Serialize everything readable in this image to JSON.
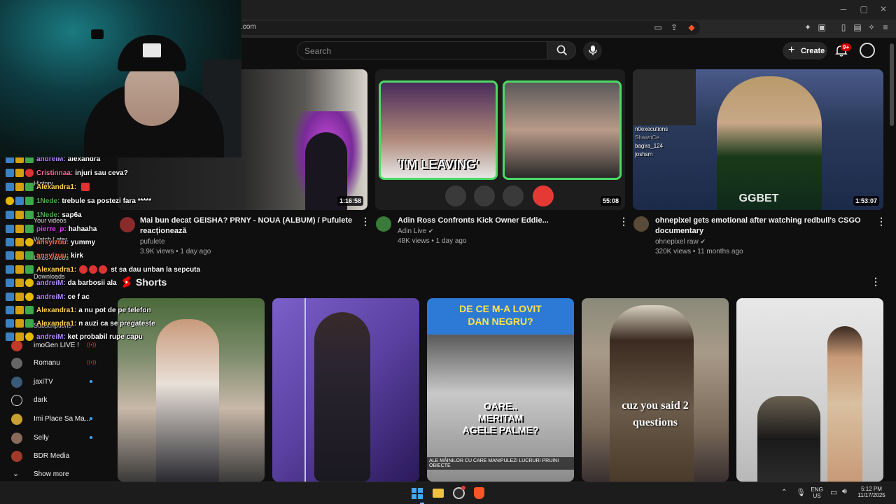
{
  "browser": {
    "url_fragment": ".com"
  },
  "header": {
    "search_placeholder": "Search",
    "create_label": "Create",
    "notification_count": "9+"
  },
  "videos": [
    {
      "title_line1": "Mai bun decat GEISHA? PRNY - NOUA (ALBUM) / Pufulete",
      "title_line2": "reacționează",
      "channel": "pufulete",
      "meta": "3.9K views • 1 day ago",
      "duration": "1:16:58"
    },
    {
      "title_line1": "Adin Ross Confronts Kick Owner Eddie...",
      "title_line2": "",
      "channel": "Adin Live",
      "meta": "48K views • 1 day ago",
      "duration": "55:08",
      "thumb_text": "'I'M LEAVING'"
    },
    {
      "title_line1": "ohnepixel gets emotional after watching redbull's CSGO",
      "title_line2": "documentary",
      "channel": "ohnepixel raw",
      "meta": "320K views • 11 months ago",
      "duration": "1:53:07",
      "thumb_chat": [
        "n0executions",
        "ShawnCe",
        "bagira_124",
        "joshsm"
      ],
      "jersey_text": "GGBET"
    }
  ],
  "shorts": {
    "section_title": "Shorts",
    "items": [
      {
        "text": ""
      },
      {
        "text": ""
      },
      {
        "text_top": "DE CE M-A LOVIT DAN NEGRU?",
        "text_mid": "OARE.. MERITAM AGELE PALME?",
        "text_bottom": "ALE MÂINILOR CU CARE MANIPULEZI LUCRURI PRUINI OBIECTE"
      },
      {
        "text_mid": "cuz you said 2 questions"
      },
      {
        "text": ""
      }
    ]
  },
  "sidebar": {
    "faded": [
      "History",
      "Your videos",
      "Watch Later",
      "Liked videos",
      "Downloads",
      "Subscriptions"
    ],
    "items": [
      {
        "name": "imoGen LIVE !",
        "status": "live",
        "color": "#c0392b"
      },
      {
        "name": "Romanu",
        "status": "live",
        "color": "#666"
      },
      {
        "name": "jaxiTV",
        "status": "new",
        "color": "#3a5a7a"
      },
      {
        "name": "dark",
        "status": "",
        "color": "#222"
      },
      {
        "name": "Imi Place Sa Ma...",
        "status": "new",
        "color": "#c8a030"
      },
      {
        "name": "Selly",
        "status": "new",
        "color": "#8a6a5a"
      },
      {
        "name": "BDR Media",
        "status": "",
        "color": "#a03a2a"
      },
      {
        "name": "Show more",
        "status": "",
        "color": ""
      }
    ]
  },
  "chat": [
    {
      "user": "andreiM:",
      "msg": "alexandra",
      "color": "#b388ff"
    },
    {
      "user": "Cristinnaa:",
      "msg": "injuri sau ceva?",
      "color": "#ff6b9d"
    },
    {
      "user": "Alexandra1:",
      "msg": "",
      "color": "#ffd54f"
    },
    {
      "user": "1Nede:",
      "msg": "trebule sa postezi fara *****",
      "color": "#4caf50"
    },
    {
      "user": "1Nede:",
      "msg": "sap6a",
      "color": "#4caf50"
    },
    {
      "user": "pierre_p:",
      "msg": "hahaaha",
      "color": "#e040fb"
    },
    {
      "user": "ansyizuu:",
      "msg": "yummy",
      "color": "#ff7043"
    },
    {
      "user": "ansyizuu:",
      "msg": "kirk",
      "color": "#ff7043"
    },
    {
      "user": "Alexandra1:",
      "msg": "st sa dau unban la sepcuta",
      "color": "#ffd54f"
    },
    {
      "user": "andreiM:",
      "msg": "da barbosii ala",
      "color": "#b388ff"
    },
    {
      "user": "andreiM:",
      "msg": "ce f ac",
      "color": "#b388ff"
    },
    {
      "user": "Alexandra1:",
      "msg": "a nu pot de pe telefon",
      "color": "#ffd54f"
    },
    {
      "user": "Alexandra1:",
      "msg": "n auzi ca se pregateste",
      "color": "#ffd54f"
    },
    {
      "user": "andreiM:",
      "msg": "ket probabil rupe capu",
      "color": "#b388ff"
    }
  ],
  "taskbar": {
    "lang_top": "ENG",
    "lang_bottom": "US",
    "time": "5:12 PM",
    "date": "11/17/2025"
  }
}
